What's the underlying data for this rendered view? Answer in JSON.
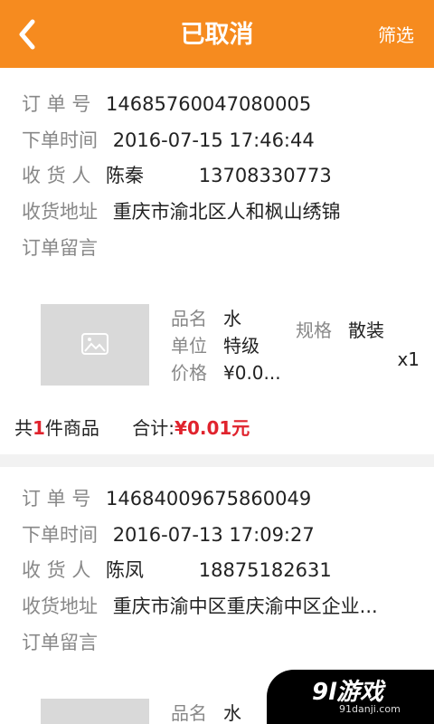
{
  "header": {
    "title": "已取消",
    "filter_label": "筛选"
  },
  "orders": [
    {
      "order_no_label": "订 单 号",
      "order_no": "14685760047080005",
      "time_label": "下单时间",
      "time": "2016-07-15 17:46:44",
      "receiver_label": "收 货 人",
      "receiver_name": "陈秦",
      "receiver_phone": "13708330773",
      "address_label": "收货地址",
      "address": "重庆市渝北区人和枫山绣锦",
      "message_label": "订单留言",
      "product": {
        "name_label": "品名",
        "name": "水",
        "unit_label": "单位",
        "unit": "特级",
        "price_label": "价格",
        "price": "¥0.0...",
        "spec_label": "规格",
        "spec": "散装",
        "quantity": "x1"
      },
      "summary": {
        "count_prefix": "共",
        "count": "1",
        "count_suffix": "件商品",
        "total_label": "合计:",
        "total": "¥0.01元"
      }
    },
    {
      "order_no_label": "订 单 号",
      "order_no": "14684009675860049",
      "time_label": "下单时间",
      "time": "2016-07-13 17:09:27",
      "receiver_label": "收 货 人",
      "receiver_name": "陈凤",
      "receiver_phone": "18875182631",
      "address_label": "收货地址",
      "address": "重庆市渝中区重庆渝中区企业...",
      "message_label": "订单留言",
      "product": {
        "name_label": "品名",
        "name": "水"
      }
    }
  ],
  "watermark": {
    "text": "9l游戏",
    "url": "91danji.com"
  },
  "colors": {
    "header_bg": "#f68b1f",
    "price_red": "#e0232d"
  }
}
